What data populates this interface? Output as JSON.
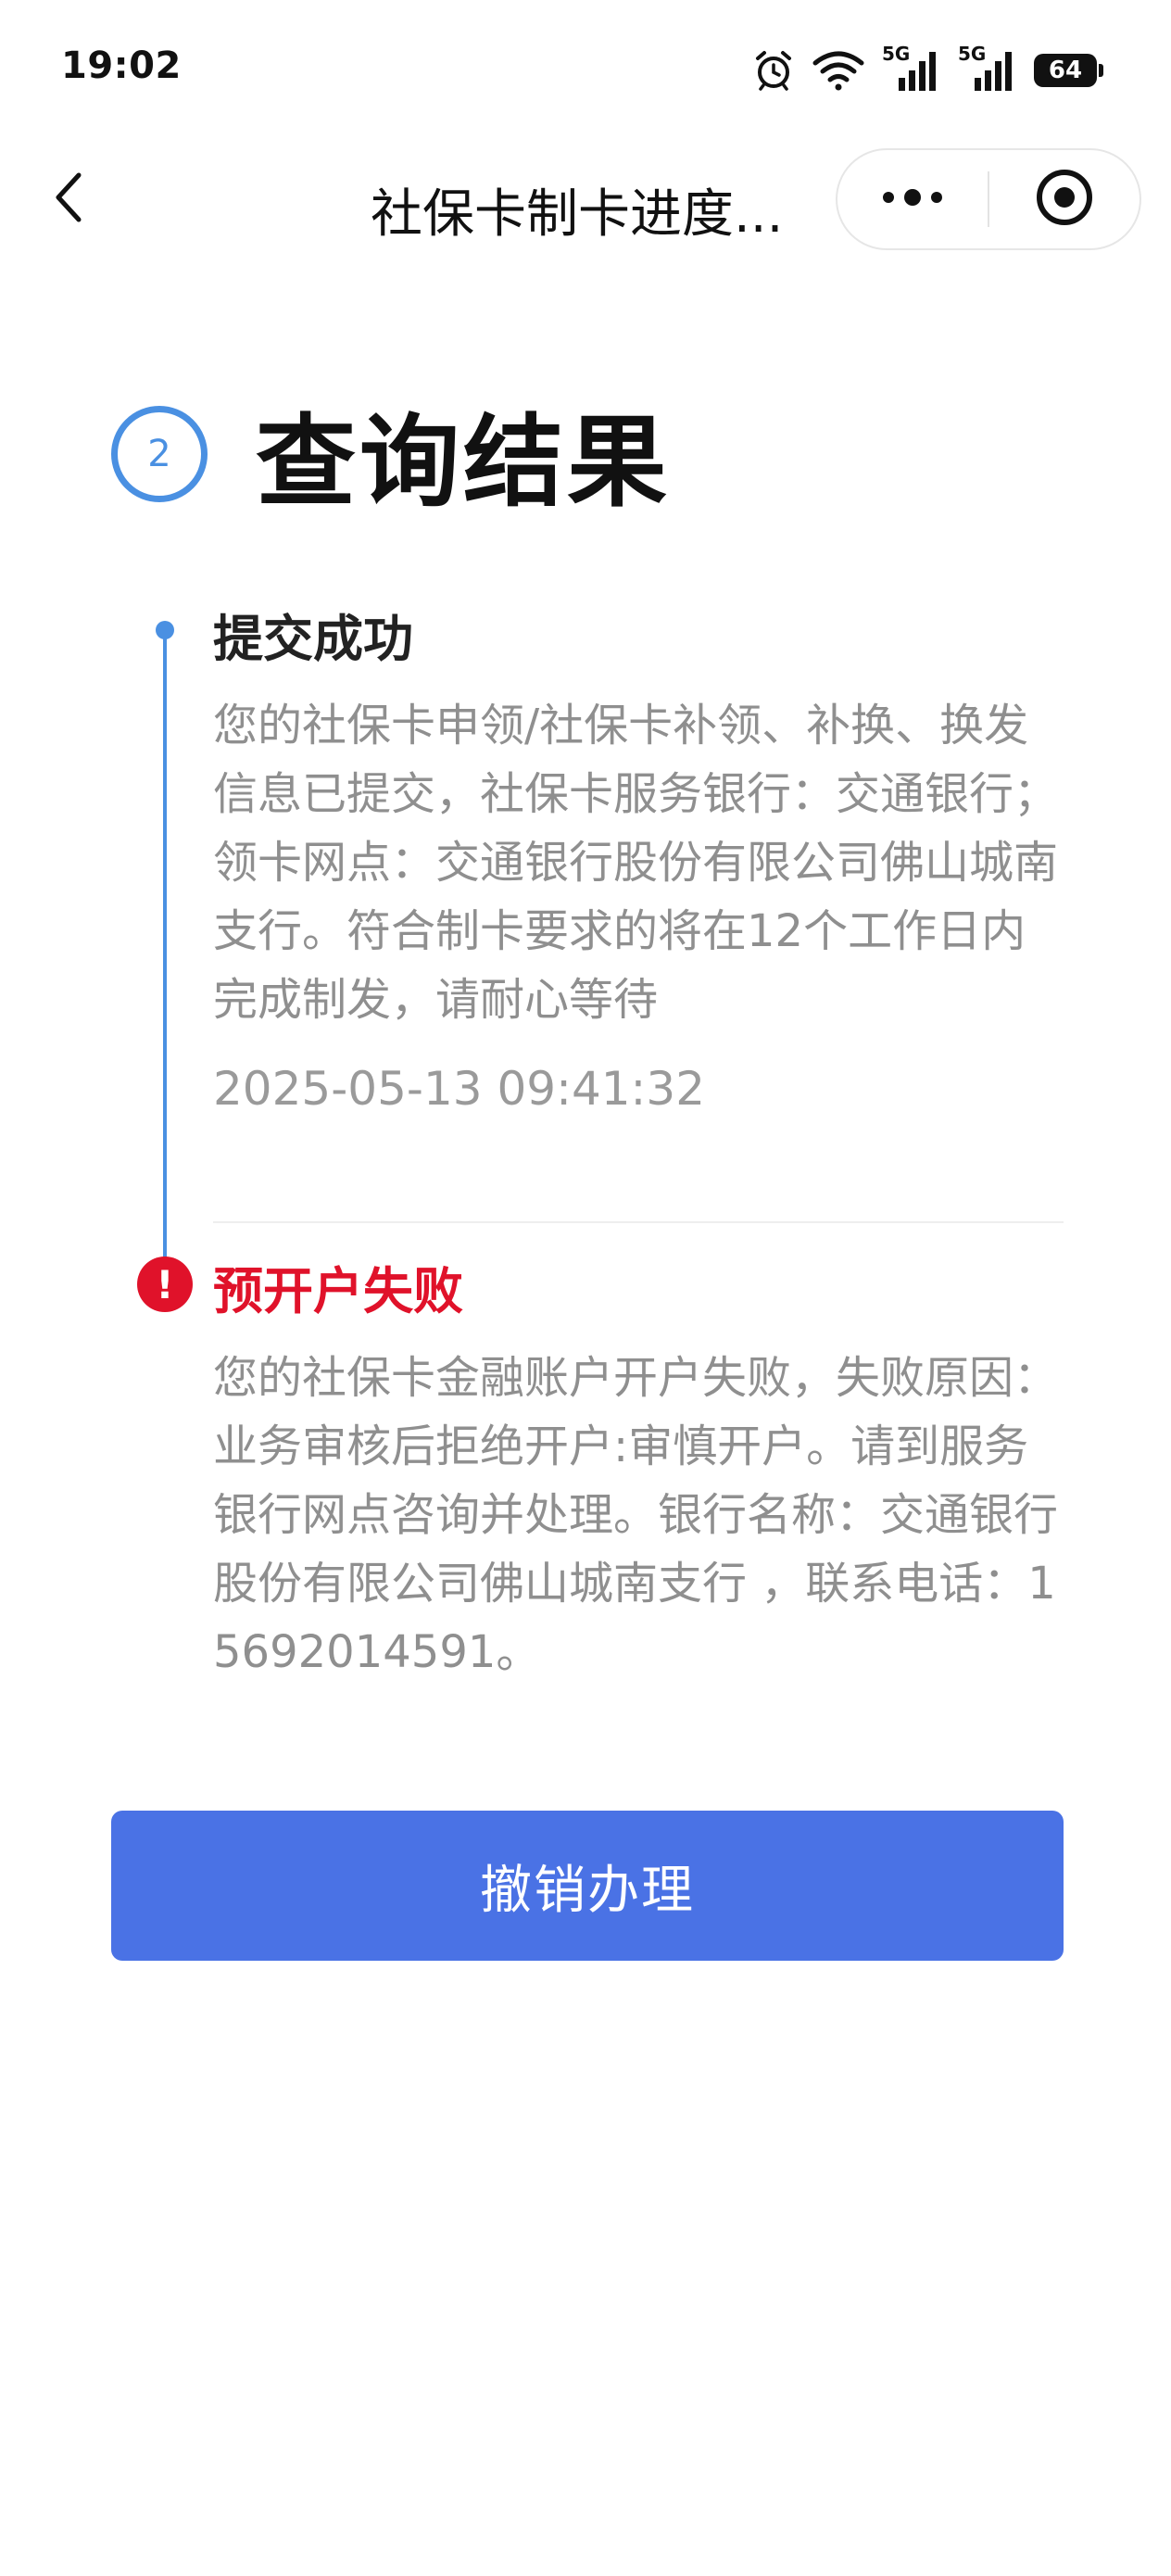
{
  "status_bar": {
    "time": "19:02",
    "signal_1_label": "5G",
    "signal_2_label": "5G",
    "battery": "64",
    "icons": [
      "alarm-icon",
      "wifi-icon",
      "signal-icon",
      "signal-icon",
      "battery-icon"
    ]
  },
  "nav": {
    "title": "社保卡制卡进度...",
    "back_icon": "chevron-left-icon",
    "more_icon": "more-dots-icon",
    "close_icon": "target-close-icon"
  },
  "step": {
    "number": "2",
    "title": "查询结果",
    "accent_color": "#4a90e2"
  },
  "timeline": [
    {
      "status": "success",
      "title": "提交成功",
      "body": "您的社保卡申领/社保卡补领、补换、换发信息已提交，社保卡服务银行：交通银行；领卡网点：交通银行股份有限公司佛山城南支行。符合制卡要求的将在12个工作日内完成制发，请耐心等待",
      "time": "2025-05-13 09:41:32"
    },
    {
      "status": "failed",
      "icon_glyph": "!",
      "title": "预开户失败",
      "title_color": "#e0122a",
      "body": "您的社保卡金融账户开户失败，失败原因：业务审核后拒绝开户:审慎开户。请到服务银行网点咨询并处理。银行名称：交通银行股份有限公司佛山城南支行 ，联系电话：15692014591。"
    }
  ],
  "actions": {
    "cancel_label": "撤销办理",
    "button_color": "#4a72e5"
  }
}
